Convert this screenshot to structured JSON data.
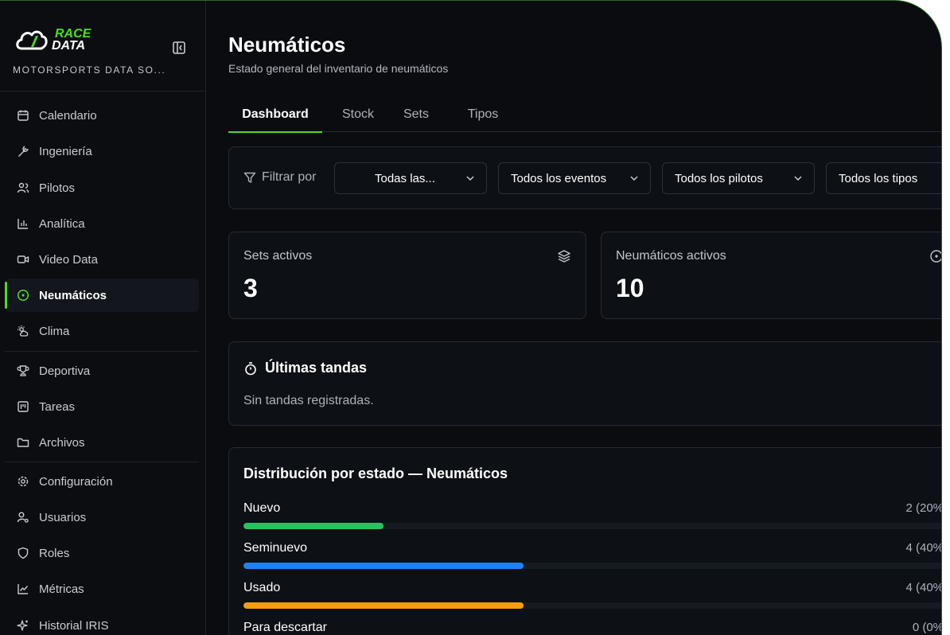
{
  "app": {
    "logo_text": "RACE DATA",
    "brand_subtitle": "MOTORSPORTS DATA SO...",
    "accent_color": "#4ade1f"
  },
  "sidebar": {
    "items": [
      {
        "label": "Calendario",
        "icon": "calendar-icon"
      },
      {
        "label": "Ingeniería",
        "icon": "wrench-icon"
      },
      {
        "label": "Pilotos",
        "icon": "users-icon"
      },
      {
        "label": "Analítica",
        "icon": "bar-chart-icon"
      },
      {
        "label": "Video Data",
        "icon": "video-icon"
      },
      {
        "label": "Neumáticos",
        "icon": "tire-icon",
        "active": true
      },
      {
        "label": "Clima",
        "icon": "weather-icon"
      },
      {
        "label": "Deportiva",
        "icon": "trophy-icon"
      },
      {
        "label": "Tareas",
        "icon": "kanban-icon"
      },
      {
        "label": "Archivos",
        "icon": "folder-icon"
      },
      {
        "label": "Configuración",
        "icon": "gear-icon"
      },
      {
        "label": "Usuarios",
        "icon": "user-settings-icon"
      },
      {
        "label": "Roles",
        "icon": "shield-icon"
      },
      {
        "label": "Métricas",
        "icon": "line-chart-icon"
      },
      {
        "label": "Historial IRIS",
        "icon": "sparkles-icon"
      }
    ]
  },
  "header": {
    "title": "Neumáticos",
    "subtitle": "Estado general del inventario de neumáticos"
  },
  "tabs": [
    {
      "label": "Dashboard",
      "active": true
    },
    {
      "label": "Stock"
    },
    {
      "label": "Sets"
    },
    {
      "label": "Tipos"
    }
  ],
  "filters": {
    "label": "Filtrar por",
    "selects": [
      {
        "value": "Todas las..."
      },
      {
        "value": "Todos los eventos"
      },
      {
        "value": "Todos los pilotos"
      },
      {
        "value": "Todos los tipos"
      }
    ]
  },
  "stats": [
    {
      "title": "Sets activos",
      "value": "3",
      "icon": "layers-icon"
    },
    {
      "title": "Neumáticos activos",
      "value": "10",
      "icon": "tire-icon"
    }
  ],
  "recent_runs": {
    "title": "Últimas tandas",
    "empty_text": "Sin tandas registradas."
  },
  "distribution": {
    "title": "Distribución por estado — Neumáticos",
    "rows": [
      {
        "label": "Nuevo",
        "count": "2 (20%",
        "fraction": 0.2,
        "color": "#22c55e"
      },
      {
        "label": "Seminuevo",
        "count": "4 (40%",
        "fraction": 0.4,
        "color": "#1d82f5"
      },
      {
        "label": "Usado",
        "count": "4 (40%",
        "fraction": 0.4,
        "color": "#f59e0b"
      },
      {
        "label": "Para descartar",
        "count": "0 (0%",
        "fraction": 0.0,
        "color": "#ef4444"
      }
    ]
  }
}
